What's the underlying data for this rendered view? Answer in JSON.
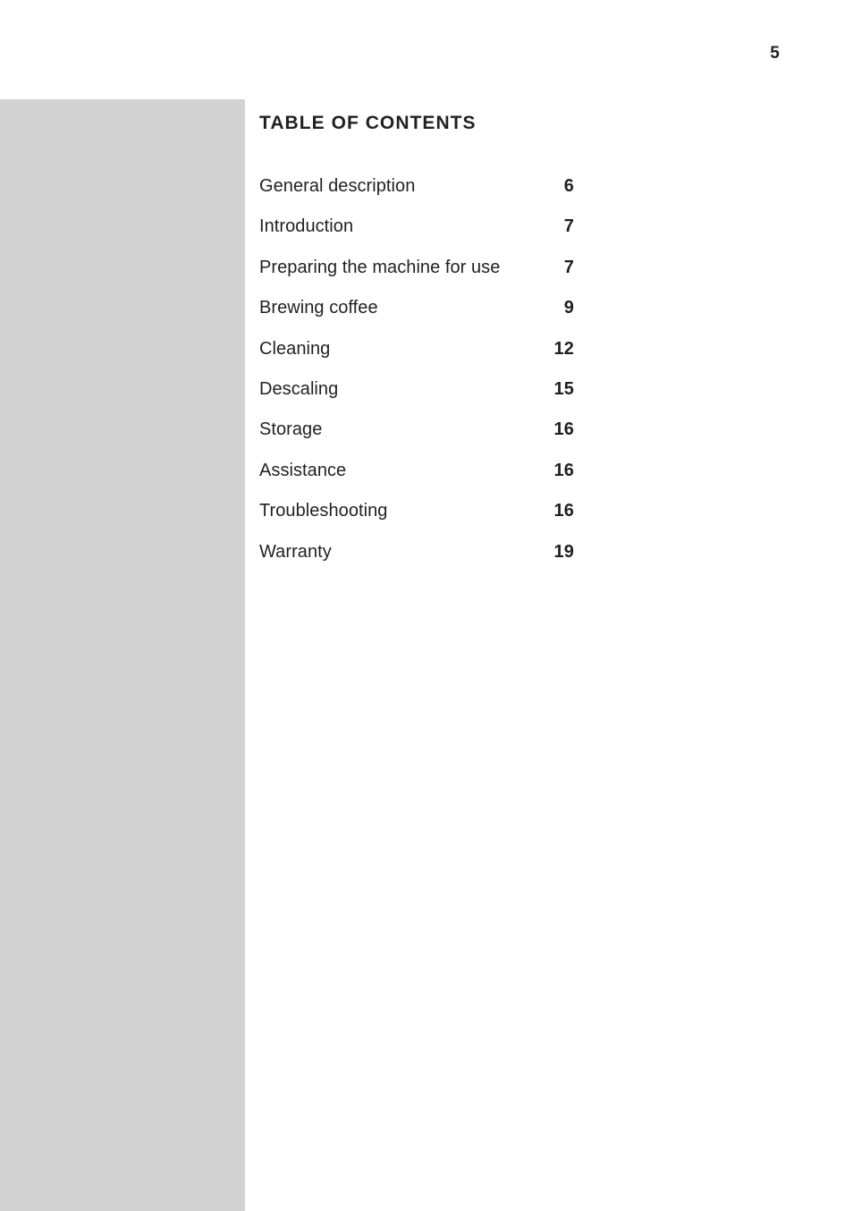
{
  "page": {
    "folio": "5",
    "background_color": "#ffffff",
    "text_color": "#231f20",
    "side_band_color": "#d2d2d2"
  },
  "toc": {
    "title": "TABLE OF CONTENTS",
    "entries": [
      {
        "label": "General description",
        "page": "6"
      },
      {
        "label": "Introduction",
        "page": "7"
      },
      {
        "label": "Preparing the machine for use",
        "page": "7"
      },
      {
        "label": "Brewing coffee",
        "page": "9"
      },
      {
        "label": "Cleaning",
        "page": "12"
      },
      {
        "label": "Descaling",
        "page": "15"
      },
      {
        "label": "Storage",
        "page": "16"
      },
      {
        "label": "Assistance",
        "page": "16"
      },
      {
        "label": "Troubleshooting",
        "page": "16"
      },
      {
        "label": "Warranty",
        "page": "19"
      }
    ]
  }
}
